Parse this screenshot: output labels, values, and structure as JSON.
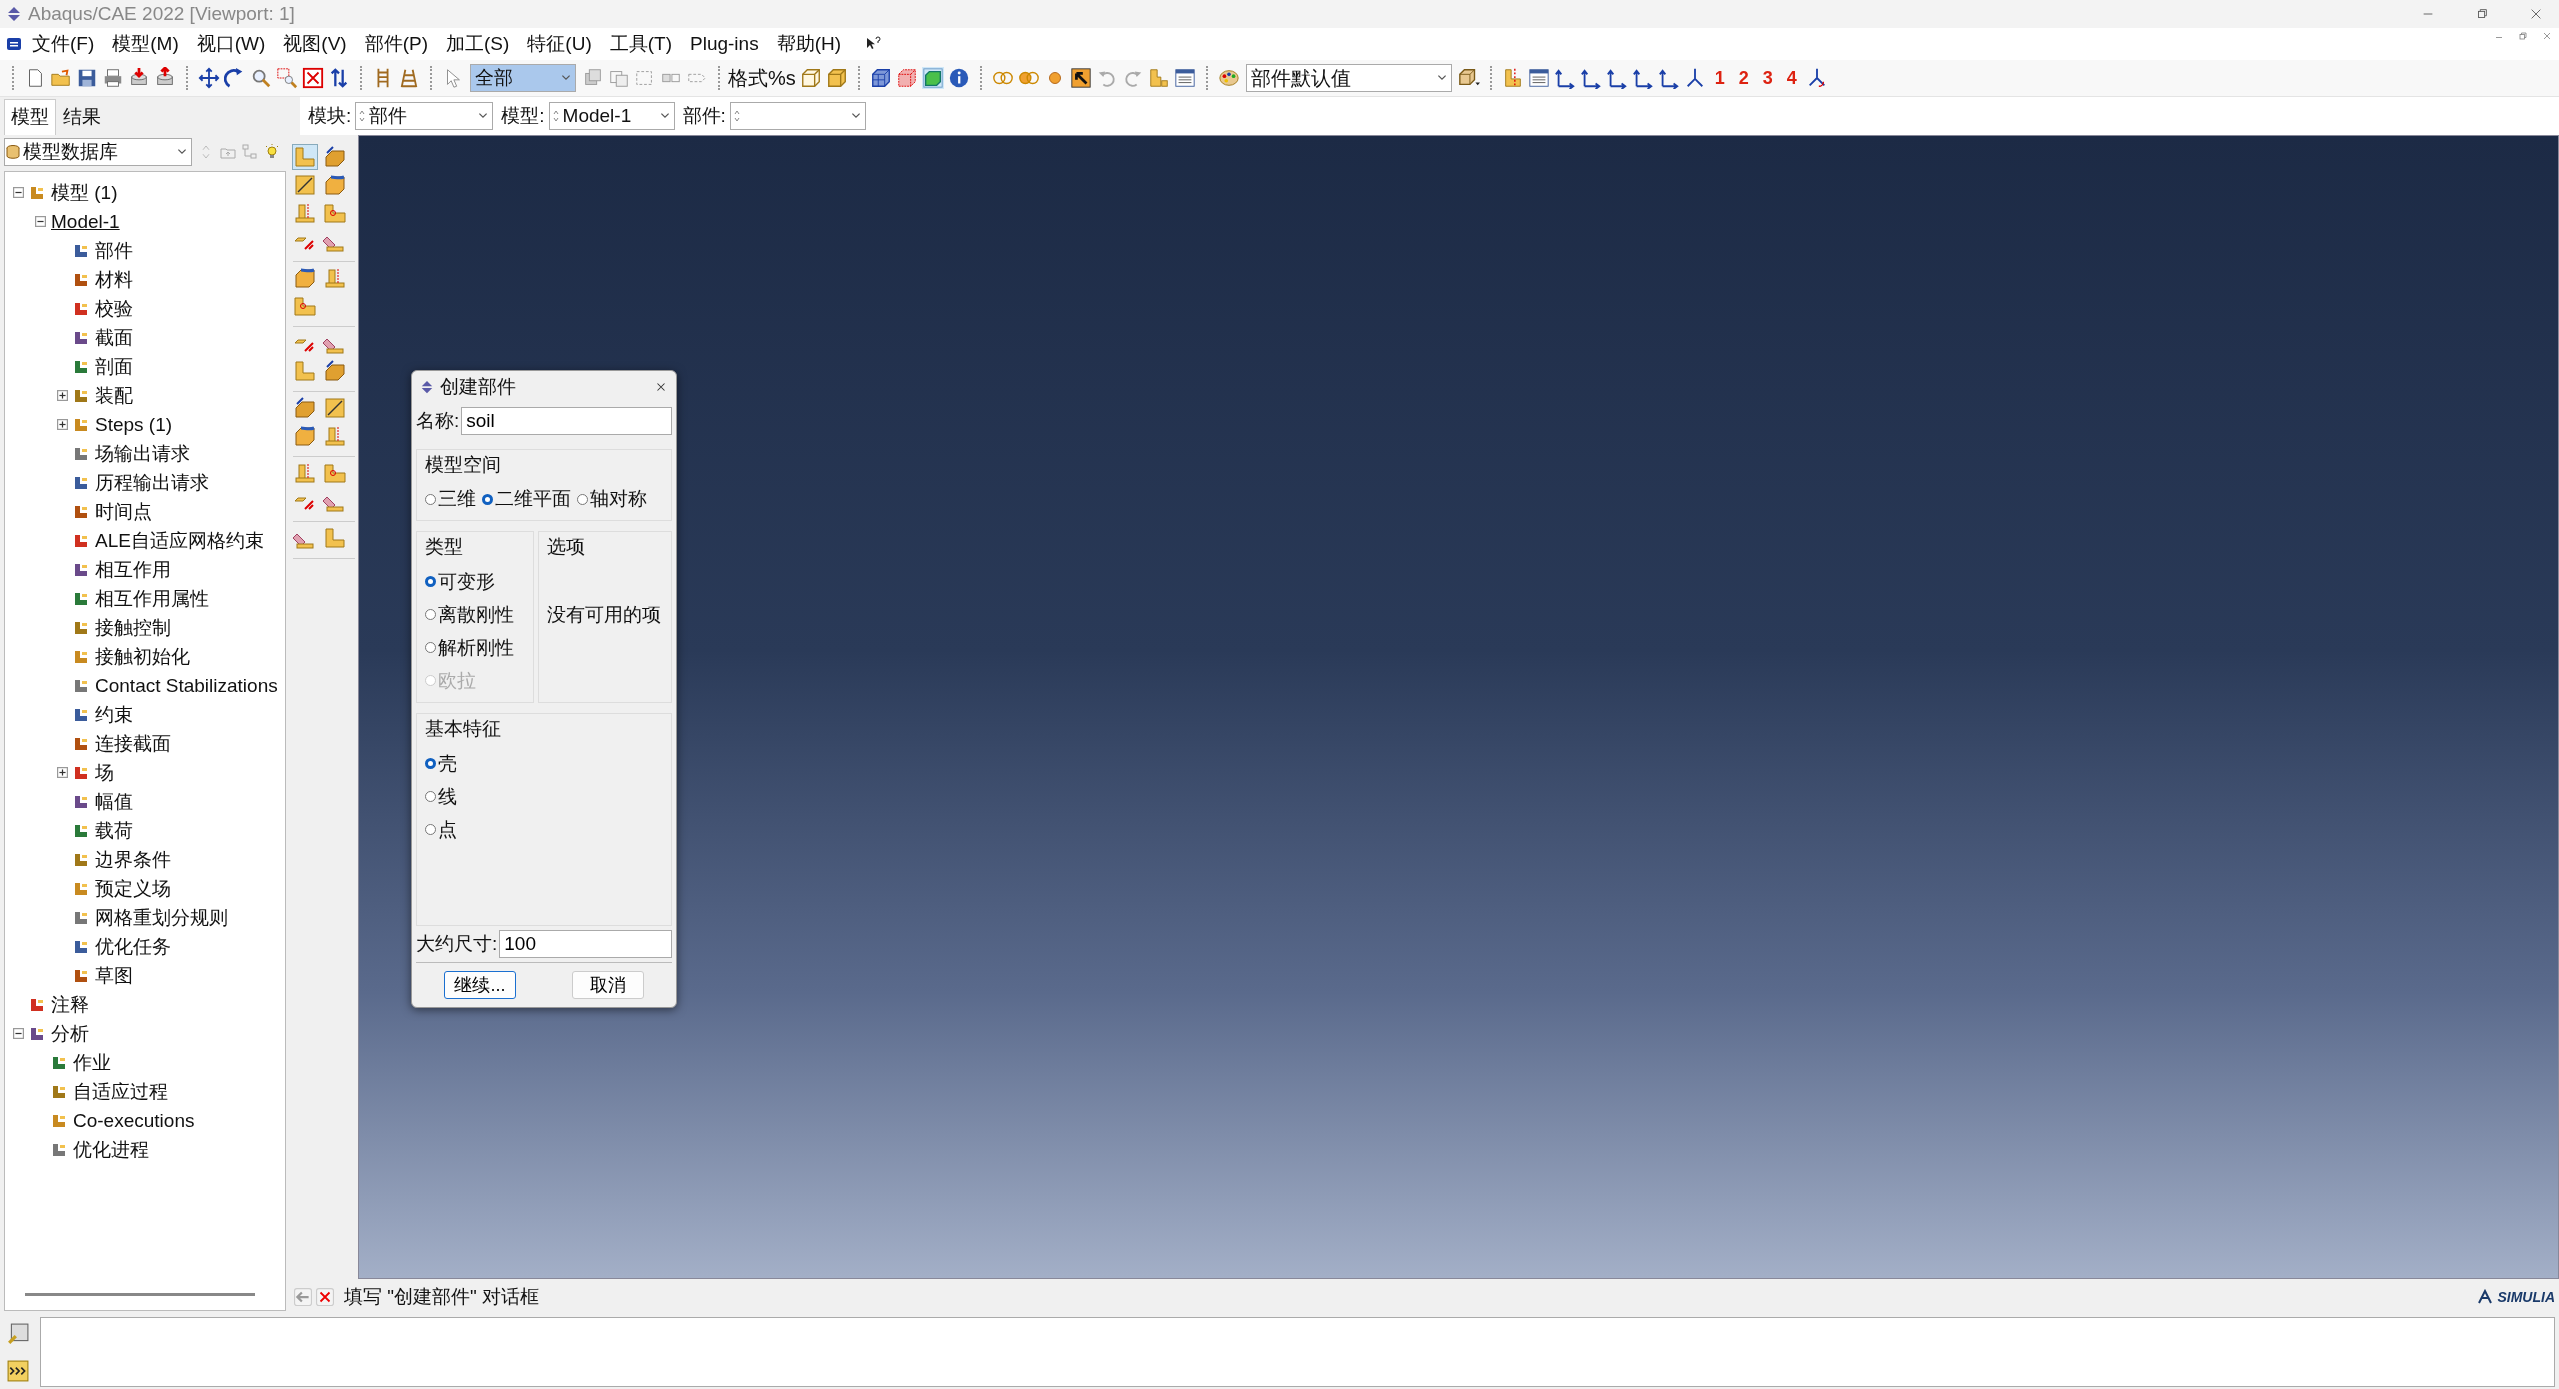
{
  "window": {
    "title": "Abaqus/CAE 2022 [Viewport: 1]"
  },
  "menu": [
    "文件(F)",
    "模型(M)",
    "视口(W)",
    "视图(V)",
    "部件(P)",
    "加工(S)",
    "特征(U)",
    "工具(T)",
    "Plug-ins",
    "帮助(H)"
  ],
  "toolbar": {
    "selection_filter": "全部",
    "format_label": "格式%s",
    "render_style": "部件默认值",
    "view_buttons": [
      "1",
      "2",
      "3",
      "4"
    ]
  },
  "context_bar": {
    "module": {
      "label": "模块:",
      "value": "部件"
    },
    "model": {
      "label": "模型:",
      "value": "Model-1"
    },
    "part": {
      "label": "部件:"
    }
  },
  "left_tabs": [
    {
      "label": "模型",
      "selected": true
    },
    {
      "label": "结果",
      "selected": false
    }
  ],
  "tree_source": "模型数据库",
  "tree": [
    {
      "label": "模型 (1)",
      "expanded": true,
      "children": [
        {
          "label": "Model-1",
          "kind": "model",
          "current": true,
          "expanded": true,
          "children": [
            {
              "label": "部件"
            },
            {
              "label": "材料"
            },
            {
              "label": "校验"
            },
            {
              "label": "截面"
            },
            {
              "label": "剖面"
            },
            {
              "label": "装配",
              "expanded": false
            },
            {
              "label": "Steps (1)",
              "expanded": false
            },
            {
              "label": "场输出请求"
            },
            {
              "label": "历程输出请求"
            },
            {
              "label": "时间点"
            },
            {
              "label": "ALE自适应网格约束"
            },
            {
              "label": "相互作用"
            },
            {
              "label": "相互作用属性"
            },
            {
              "label": "接触控制"
            },
            {
              "label": "接触初始化"
            },
            {
              "label": "Contact Stabilizations"
            },
            {
              "label": "约束"
            },
            {
              "label": "连接截面"
            },
            {
              "label": "场",
              "expanded": false
            },
            {
              "label": "幅值"
            },
            {
              "label": "载荷"
            },
            {
              "label": "边界条件"
            },
            {
              "label": "预定义场"
            },
            {
              "label": "网格重划分规则"
            },
            {
              "label": "优化任务"
            },
            {
              "label": "草图"
            }
          ]
        }
      ]
    },
    {
      "label": "注释"
    },
    {
      "label": "分析",
      "expanded": true,
      "children": [
        {
          "label": "作业"
        },
        {
          "label": "自适应过程"
        },
        {
          "label": "Co-executions"
        },
        {
          "label": "优化进程"
        }
      ]
    }
  ],
  "dialog": {
    "title": "创建部件",
    "name_label": "名称:",
    "name_value": "soil",
    "modeling_space": {
      "title": "模型空间",
      "options": [
        {
          "label": "三维",
          "selected": false
        },
        {
          "label": "二维平面",
          "selected": true
        },
        {
          "label": "轴对称",
          "selected": false
        }
      ]
    },
    "type": {
      "title": "类型",
      "options": [
        {
          "label": "可变形",
          "selected": true,
          "disabled": false
        },
        {
          "label": "离散刚性",
          "selected": false,
          "disabled": false
        },
        {
          "label": "解析刚性",
          "selected": false,
          "disabled": false
        },
        {
          "label": "欧拉",
          "selected": false,
          "disabled": true
        }
      ]
    },
    "options": {
      "title": "选项",
      "message": "没有可用的项"
    },
    "base_feature": {
      "title": "基本特征",
      "options": [
        {
          "label": "壳",
          "selected": true
        },
        {
          "label": "线",
          "selected": false
        },
        {
          "label": "点",
          "selected": false
        }
      ]
    },
    "size_label": "大约尺寸:",
    "size_value": "100",
    "buttons": [
      {
        "label": "继续...",
        "focused": true
      },
      {
        "label": "取消",
        "focused": false
      }
    ]
  },
  "prompt": {
    "text": "填写 \"创建部件\" 对话框"
  },
  "brand": "SIMULIA"
}
